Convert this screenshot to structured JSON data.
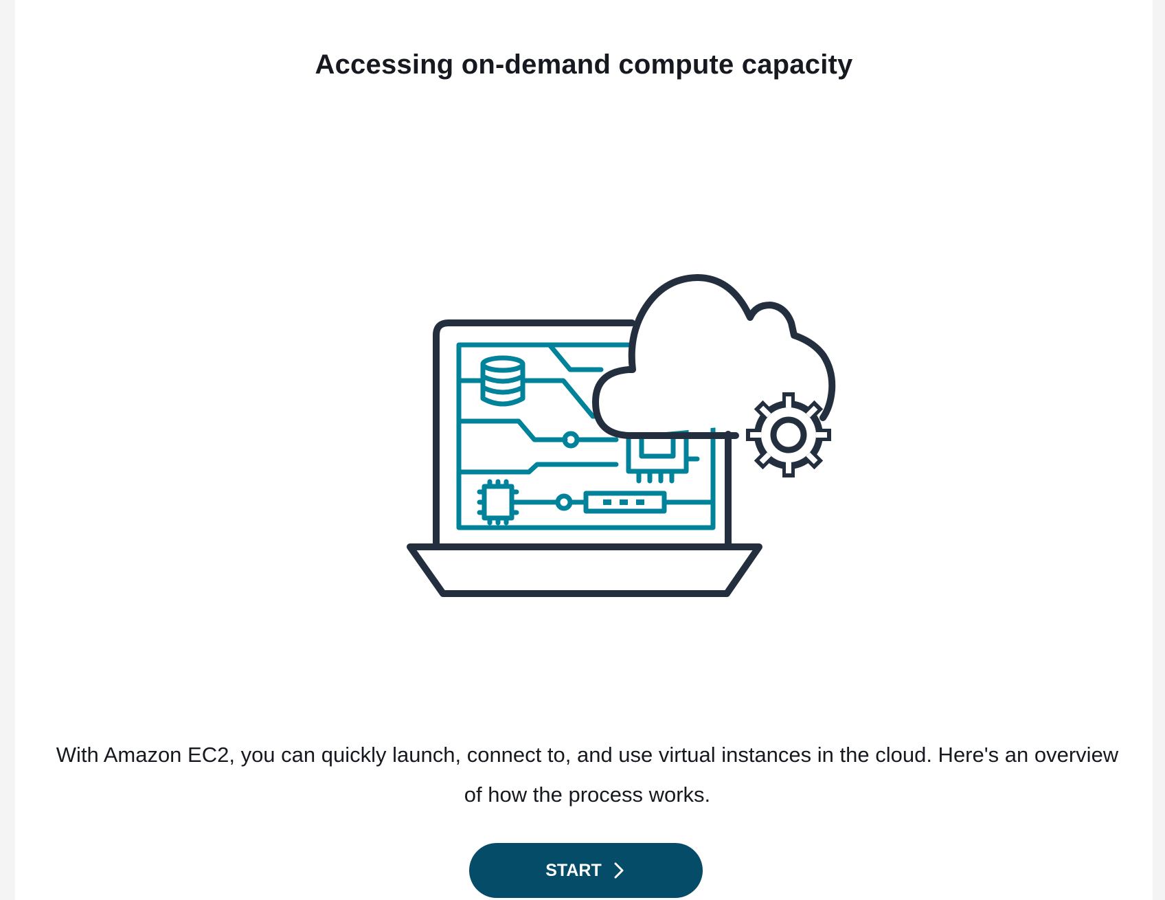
{
  "header": {
    "title": "Accessing on-demand compute capacity"
  },
  "hero": {
    "illustration": "laptop-circuit-cloud-gear-illustration",
    "colors": {
      "outline": "#232f3e",
      "circuit": "#00829b"
    }
  },
  "main": {
    "description": "With Amazon EC2, you can quickly launch, connect to, and use virtual instances in the cloud. Here's an overview of how the process works."
  },
  "actions": {
    "start_label": "START",
    "start_icon": "chevron-right-icon",
    "button_color": "#054c68"
  }
}
